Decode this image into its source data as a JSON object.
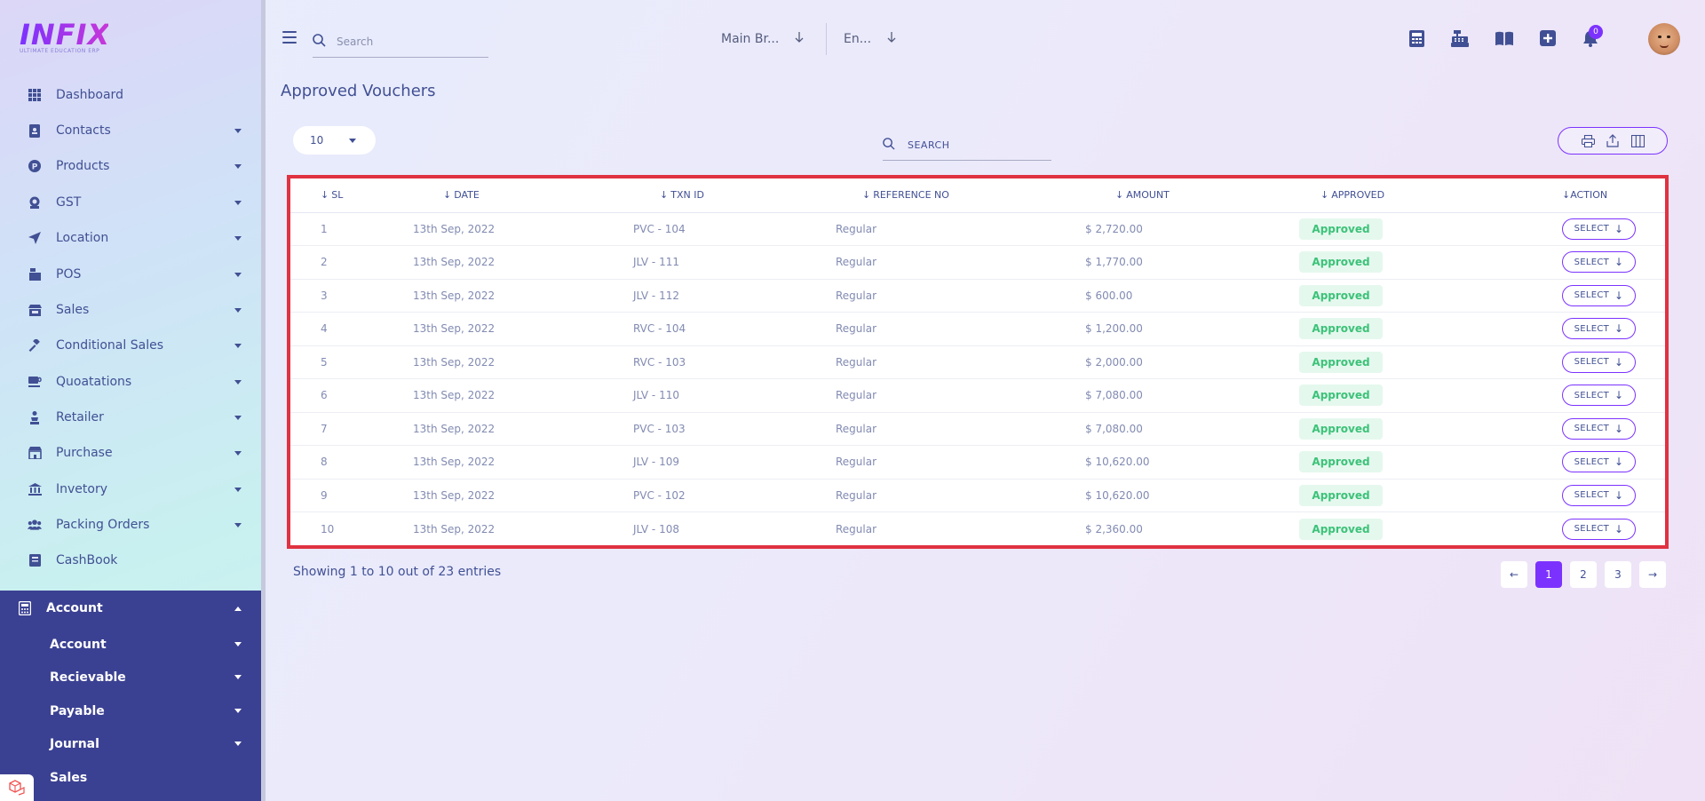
{
  "app": {
    "logo_text": "INFIX",
    "logo_tagline": "ULTIMATE EDUCATION ERP",
    "page_title": "Approved Vouchers"
  },
  "sidebar": {
    "items": [
      {
        "label": "Dashboard",
        "icon": "grid-icon"
      },
      {
        "label": "Contacts",
        "icon": "contact-book-icon"
      },
      {
        "label": "Products",
        "icon": "product-icon"
      },
      {
        "label": "GST",
        "icon": "gst-icon"
      },
      {
        "label": "Location",
        "icon": "location-arrow-icon"
      },
      {
        "label": "POS",
        "icon": "pos-icon"
      },
      {
        "label": "Sales",
        "icon": "store-icon"
      },
      {
        "label": "Conditional Sales",
        "icon": "gavel-icon"
      },
      {
        "label": "Quoatations",
        "icon": "coffee-icon"
      },
      {
        "label": "Retailer",
        "icon": "retailer-icon"
      },
      {
        "label": "Purchase",
        "icon": "shop-icon"
      },
      {
        "label": "Invetory",
        "icon": "bank-icon"
      },
      {
        "label": "Packing Orders",
        "icon": "users-icon"
      },
      {
        "label": "CashBook",
        "icon": "cashbook-icon"
      }
    ],
    "active": {
      "label": "Account",
      "icon": "calculator-icon"
    },
    "sub_items": [
      {
        "label": "Account"
      },
      {
        "label": "Recievable"
      },
      {
        "label": "Payable"
      },
      {
        "label": "Journal"
      },
      {
        "label": "Sales"
      }
    ]
  },
  "topbar": {
    "search_placeholder": "Search",
    "branch_label": "Main Br...",
    "language_label": "En...",
    "notification_count": "0",
    "icons": [
      "calculator-icon",
      "cash-register-icon",
      "book-icon",
      "plus-square-icon",
      "bell-icon"
    ]
  },
  "table_controls": {
    "page_size": "10",
    "search_placeholder": "SEARCH",
    "tools": [
      "print-icon",
      "export-icon",
      "columns-icon"
    ]
  },
  "table": {
    "columns": [
      "SL",
      "DATE",
      "TXN ID",
      "REFERENCE NO",
      "AMOUNT",
      "APPROVED",
      "ACTION"
    ],
    "rows": [
      {
        "sl": "1",
        "date": "13th Sep, 2022",
        "txn": "PVC - 104",
        "ref": "Regular",
        "amount": "$ 2,720.00",
        "status": "Approved",
        "action": "SELECT"
      },
      {
        "sl": "2",
        "date": "13th Sep, 2022",
        "txn": "JLV - 111",
        "ref": "Regular",
        "amount": "$ 1,770.00",
        "status": "Approved",
        "action": "SELECT"
      },
      {
        "sl": "3",
        "date": "13th Sep, 2022",
        "txn": "JLV - 112",
        "ref": "Regular",
        "amount": "$ 600.00",
        "status": "Approved",
        "action": "SELECT"
      },
      {
        "sl": "4",
        "date": "13th Sep, 2022",
        "txn": "RVC - 104",
        "ref": "Regular",
        "amount": "$ 1,200.00",
        "status": "Approved",
        "action": "SELECT"
      },
      {
        "sl": "5",
        "date": "13th Sep, 2022",
        "txn": "RVC - 103",
        "ref": "Regular",
        "amount": "$ 2,000.00",
        "status": "Approved",
        "action": "SELECT"
      },
      {
        "sl": "6",
        "date": "13th Sep, 2022",
        "txn": "JLV - 110",
        "ref": "Regular",
        "amount": "$ 7,080.00",
        "status": "Approved",
        "action": "SELECT"
      },
      {
        "sl": "7",
        "date": "13th Sep, 2022",
        "txn": "PVC - 103",
        "ref": "Regular",
        "amount": "$ 7,080.00",
        "status": "Approved",
        "action": "SELECT"
      },
      {
        "sl": "8",
        "date": "13th Sep, 2022",
        "txn": "JLV - 109",
        "ref": "Regular",
        "amount": "$ 10,620.00",
        "status": "Approved",
        "action": "SELECT"
      },
      {
        "sl": "9",
        "date": "13th Sep, 2022",
        "txn": "PVC - 102",
        "ref": "Regular",
        "amount": "$ 10,620.00",
        "status": "Approved",
        "action": "SELECT"
      },
      {
        "sl": "10",
        "date": "13th Sep, 2022",
        "txn": "JLV - 108",
        "ref": "Regular",
        "amount": "$ 2,360.00",
        "status": "Approved",
        "action": "SELECT"
      }
    ]
  },
  "footer": {
    "entries_text": "Showing 1 to 10 out of 23 entries",
    "prev": "←",
    "next": "→",
    "pages": [
      "1",
      "2",
      "3"
    ],
    "active_page": "1"
  },
  "colors": {
    "primary": "#415094",
    "accent": "#7c32ff",
    "active_nav": "#3b4192",
    "success": "#3cc278",
    "highlight_border": "#e03241"
  }
}
